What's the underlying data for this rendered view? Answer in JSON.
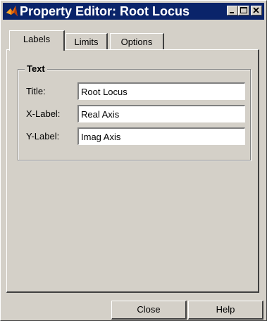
{
  "window": {
    "title": "Property Editor: Root Locus",
    "icon": "matlab-icon"
  },
  "titlebar_buttons": [
    "minimize",
    "maximize",
    "close"
  ],
  "tabs": [
    {
      "label": "Labels",
      "active": true
    },
    {
      "label": "Limits",
      "active": false
    },
    {
      "label": "Options",
      "active": false
    }
  ],
  "text_group": {
    "label": "Text",
    "fields": [
      {
        "label": "Title:",
        "value": "Root Locus"
      },
      {
        "label": "X-Label:",
        "value": "Real Axis"
      },
      {
        "label": "Y-Label:",
        "value": "Imag Axis"
      }
    ]
  },
  "buttons": {
    "close": "Close",
    "help": "Help"
  }
}
